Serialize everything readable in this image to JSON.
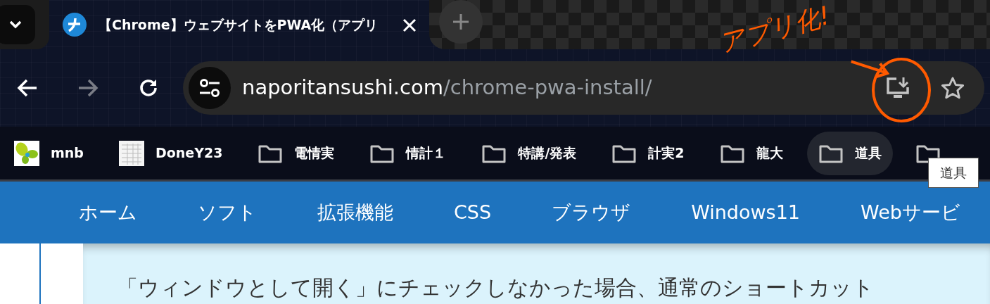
{
  "tab_strip": {
    "tabs": [
      {
        "title": "【Chrome】ウェブサイトをPWA化（アプリ",
        "selected": true
      }
    ]
  },
  "toolbar": {
    "forward_disabled": true,
    "url": {
      "domain": "naporitansushi.com",
      "path": "/chrome-pwa-install/"
    }
  },
  "annotation": {
    "text": "アプリ化!"
  },
  "bookmarks": [
    {
      "kind": "site",
      "label": "mnb",
      "hovered": false
    },
    {
      "kind": "sheet",
      "label": "DoneY23",
      "hovered": false
    },
    {
      "kind": "folder",
      "label": "電情実",
      "hovered": false
    },
    {
      "kind": "folder",
      "label": "情計１",
      "hovered": false
    },
    {
      "kind": "folder",
      "label": "特講/発表",
      "hovered": false
    },
    {
      "kind": "folder",
      "label": "計実2",
      "hovered": false
    },
    {
      "kind": "folder",
      "label": "龍大",
      "hovered": false
    },
    {
      "kind": "folder",
      "label": "道具",
      "hovered": true
    },
    {
      "kind": "folder",
      "hovered": false
    }
  ],
  "tooltip": "道具",
  "nav": [
    "ホーム",
    "ソフト",
    "拡張機能",
    "CSS",
    "ブラウザ",
    "Windows11",
    "Webサービ"
  ],
  "content": {
    "text": "「ウィンドウとして開く」にチェックしなかった場合、通常のショートカット"
  }
}
